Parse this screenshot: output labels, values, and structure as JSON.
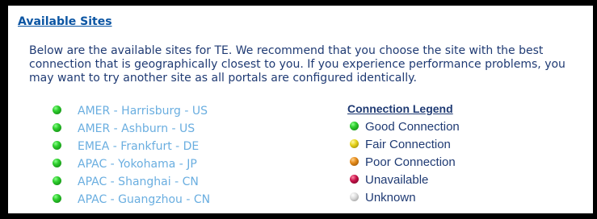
{
  "page": {
    "title": "Available Sites",
    "intro_lines": [
      "Below are the available sites for TE.  We recommend that you choose the site with the best",
      "connection that is geographically closest to you.  If you experience performance problems, you",
      "may want to try another site as all portals are configured identically."
    ]
  },
  "sites": [
    {
      "label": "AMER - Harrisburg - US",
      "status": "green"
    },
    {
      "label": "AMER - Ashburn - US",
      "status": "green"
    },
    {
      "label": "EMEA - Frankfurt - DE",
      "status": "green"
    },
    {
      "label": "APAC - Yokohama - JP",
      "status": "green"
    },
    {
      "label": "APAC - Shanghai - CN",
      "status": "green"
    },
    {
      "label": "APAC - Guangzhou - CN",
      "status": "green"
    }
  ],
  "legend": {
    "title": "Connection Legend",
    "items": [
      {
        "label": "Good Connection",
        "color": "#2fcf2f"
      },
      {
        "label": "Fair Connection",
        "color": "#e6d21a"
      },
      {
        "label": "Poor Connection",
        "color": "#e48a1a"
      },
      {
        "label": "Unavailable",
        "color": "#c8134a"
      },
      {
        "label": "Unknown",
        "color": "#d8d8d8"
      }
    ]
  },
  "colors": {
    "title_link": "#0b55a3",
    "body_text": "#1f3a73",
    "site_link": "#6aaee0",
    "frame": "#000000"
  }
}
